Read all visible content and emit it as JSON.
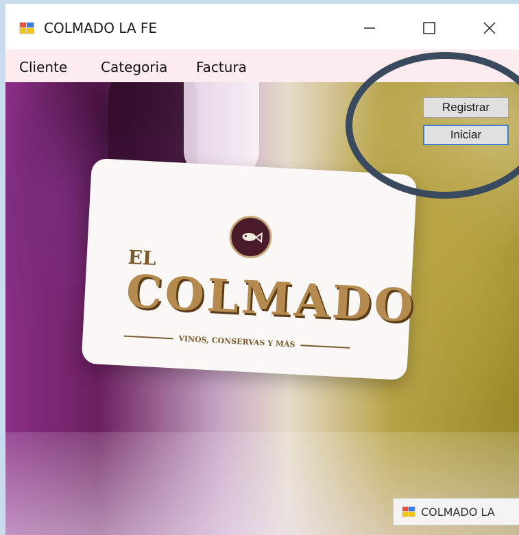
{
  "window": {
    "title": "COLMADO LA FE",
    "controls": {
      "minimize_icon": "minimize-icon",
      "maximize_icon": "maximize-icon",
      "close_icon": "close-icon"
    }
  },
  "menu": {
    "items": [
      {
        "label": "Cliente"
      },
      {
        "label": "Categoria"
      },
      {
        "label": "Factura"
      }
    ]
  },
  "buttons": {
    "registrar": "Registrar",
    "iniciar": "Iniciar"
  },
  "logo": {
    "el": "EL",
    "main": "COLMADO",
    "tagline": "VINOS, CONSERVAS Y MÁS"
  },
  "taskbar": {
    "label": "COLMADO LA"
  },
  "colors": {
    "highlight_ring": "#3a4a5e",
    "button_focus": "#3c7fcf",
    "menu_bg": "#fdecef"
  }
}
